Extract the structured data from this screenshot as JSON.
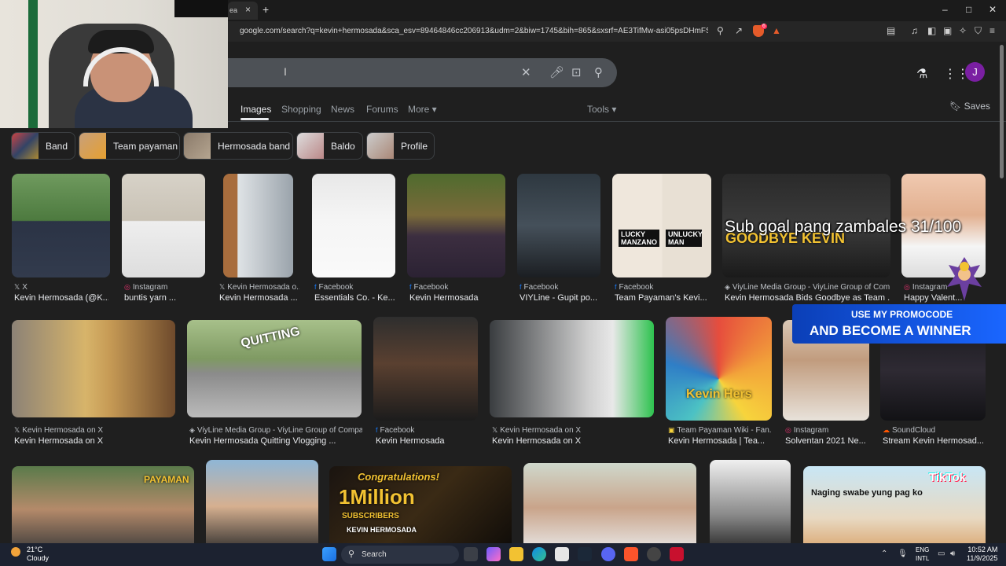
{
  "browser": {
    "tab_title": "ea",
    "url": "google.com/search?q=kevin+hermosada&sca_esv=89464846cc206913&udm=2&biw=1745&bih=865&sxsrf=AE3TifMw-asi05psDHmFSumk2ir...",
    "new_tab_label": "+",
    "tab_close": "×",
    "window_controls": [
      "–",
      "□",
      "✕"
    ]
  },
  "search": {
    "cursor": "I"
  },
  "tabs": [
    {
      "label": "Images",
      "active": true
    },
    {
      "label": "Shopping"
    },
    {
      "label": "News"
    },
    {
      "label": "Forums"
    },
    {
      "label": "More ▾"
    }
  ],
  "tools_label": "Tools ▾",
  "saves_label": "Saves",
  "avatar_letter": "J",
  "chips": [
    {
      "label": "Band"
    },
    {
      "label": "Team payaman"
    },
    {
      "label": "Hermosada band"
    },
    {
      "label": "Baldo"
    },
    {
      "label": "Profile"
    }
  ],
  "results_row1": [
    {
      "source": "X",
      "icon": "x-icon",
      "title": "Kevin Hermosada (@K..."
    },
    {
      "source": "Instagram",
      "icon": "instagram-icon",
      "title": "buntis yarn ..."
    },
    {
      "source": "Kevin Hermosada o...",
      "icon": "x-icon",
      "title": "Kevin Hermosada ..."
    },
    {
      "source": "Facebook",
      "icon": "facebook-icon",
      "title": "Essentials Co. - Ke..."
    },
    {
      "source": "Facebook",
      "icon": "facebook-icon",
      "title": "Kevin Hermosada"
    },
    {
      "source": "Facebook",
      "icon": "facebook-icon",
      "title": "VIYLine - Gupit po..."
    },
    {
      "source": "Facebook",
      "icon": "facebook-icon",
      "title": "Team Payaman's Kevi..."
    },
    {
      "source": "ViyLine Media Group - ViyLine Group of Com...",
      "icon": "viyline-icon",
      "title": "Kevin Hermosada Bids Goodbye as Team ..."
    },
    {
      "source": "Instagram",
      "icon": "instagram-icon",
      "title": "Happy Valent..."
    }
  ],
  "results_row2": [
    {
      "source": "Kevin Hermosada on X",
      "icon": "x-icon",
      "title": "Kevin Hermosada on X"
    },
    {
      "source": "ViyLine Media Group - ViyLine Group of Compa...",
      "icon": "viyline-icon",
      "title": "Kevin Hermosada Quitting Vlogging ..."
    },
    {
      "source": "Facebook",
      "icon": "facebook-icon",
      "title": "Kevin Hermosada"
    },
    {
      "source": "Kevin Hermosada on X",
      "icon": "x-icon",
      "title": "Kevin Hermosada on X"
    },
    {
      "source": "Team Payaman Wiki - Fan...",
      "icon": "fandom-icon",
      "title": "Kevin Hermosada | Tea..."
    },
    {
      "source": "Instagram",
      "icon": "instagram-icon",
      "title": "Solventan 2021 Ne..."
    },
    {
      "source": "SoundCloud",
      "icon": "soundcloud-icon",
      "title": "Stream Kevin Hermosad..."
    }
  ],
  "image_text": {
    "lucky": "LUCKY MANZANO",
    "unlucky": "UNLUCKY MAN",
    "goodbye": "GOODBYE KEVIN",
    "quitting": "QUITTING",
    "team_payaman": "PAYAMAN",
    "kevin_hers": "Kevin Hers",
    "congrats": "Congratulations!",
    "million": "1Million",
    "subscribers": "SUBSCRIBERS",
    "kevin_name": "KEVIN HERMOSADA",
    "tiktok": "TikTok",
    "swabe": "Naging swabe yung pag ko"
  },
  "overlays": {
    "sub_goal": "Sub goal pang zambales 31/100",
    "promo_line1": "USE MY PROMOCODE",
    "promo_line2": "AND BECOME A WINNER"
  },
  "taskbar": {
    "temp": "21°C",
    "weather": "Cloudy",
    "search_label": "Search",
    "lang1": "ENG",
    "lang2": "INTL",
    "time": "10:52 AM",
    "date": "11/9/2025"
  },
  "colors": {
    "background": "#1f1f1f",
    "avatar": "#7a1fa2",
    "promo": "#1a66ff"
  }
}
